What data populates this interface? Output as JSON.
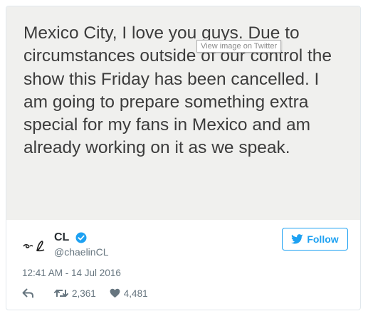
{
  "media": {
    "tweet_image_text": "Mexico City, I love you guys. Due to circumstances outside of our control the show this Friday has been cancelled. I am going to prepare something extra special for my fans in Mexico and am already working on it as we speak.",
    "tooltip": "View image on Twitter"
  },
  "author": {
    "name": "CL",
    "handle": "@chaelinCL",
    "verified": true,
    "avatar_icon": "signature-avatar-icon"
  },
  "follow": {
    "label": "Follow",
    "icon": "twitter-bird-icon"
  },
  "timestamp": "12:41 AM - 14 Jul 2016",
  "actions": {
    "reply_icon": "reply-icon",
    "retweet_count": "2,361",
    "like_count": "4,481"
  },
  "colors": {
    "twitter_blue": "#1da1f2",
    "image_background": "#f0f0ee",
    "image_text": "#3c3c3c",
    "muted_text": "#66757f"
  }
}
